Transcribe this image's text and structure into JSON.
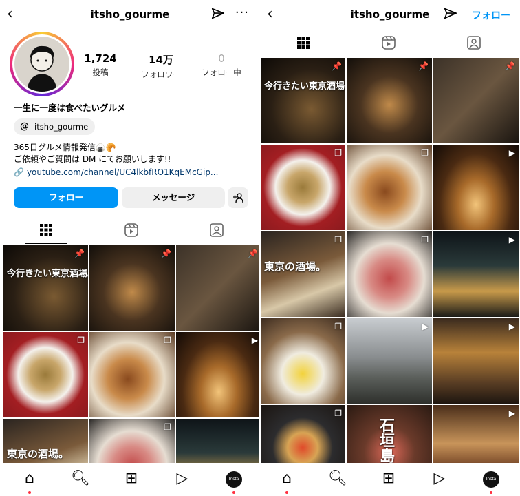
{
  "profile": {
    "username": "itsho_gourme",
    "stats": [
      {
        "value": "1,724",
        "label": "投稿"
      },
      {
        "value": "14万",
        "label": "フォロワー"
      },
      {
        "value": "0",
        "label": "フォロー中"
      }
    ],
    "display_name": "一生に一度は食べたいグルメ",
    "threads_handle": "itsho_gourme",
    "bio_line1": "365日グルメ情報発信🍙🥐",
    "bio_line2": "ご依頼やご質問は DM にてお願いします!!",
    "link": "youtube.com/channel/UC4lkbfRO1KqEMcGip..."
  },
  "buttons": {
    "follow": "フォロー",
    "message": "メッセージ",
    "add_user": "+👤"
  },
  "header_right": {
    "follow_link": "フォロー"
  },
  "tabs": [
    {
      "name": "grid",
      "icon": "grid-icon"
    },
    {
      "name": "reels",
      "icon": "reels-icon"
    },
    {
      "name": "tagged",
      "icon": "tagged-icon"
    }
  ],
  "captions": {
    "tokyo_sakaba": "今行きたい東京酒場。",
    "tokyo_no_sakaba": "東京の酒場。",
    "ishigaki": "石垣島"
  },
  "nav_avatar_text": "Insta Lab",
  "colors": {
    "accent": "#0095f6",
    "badge": "#ff3040"
  }
}
